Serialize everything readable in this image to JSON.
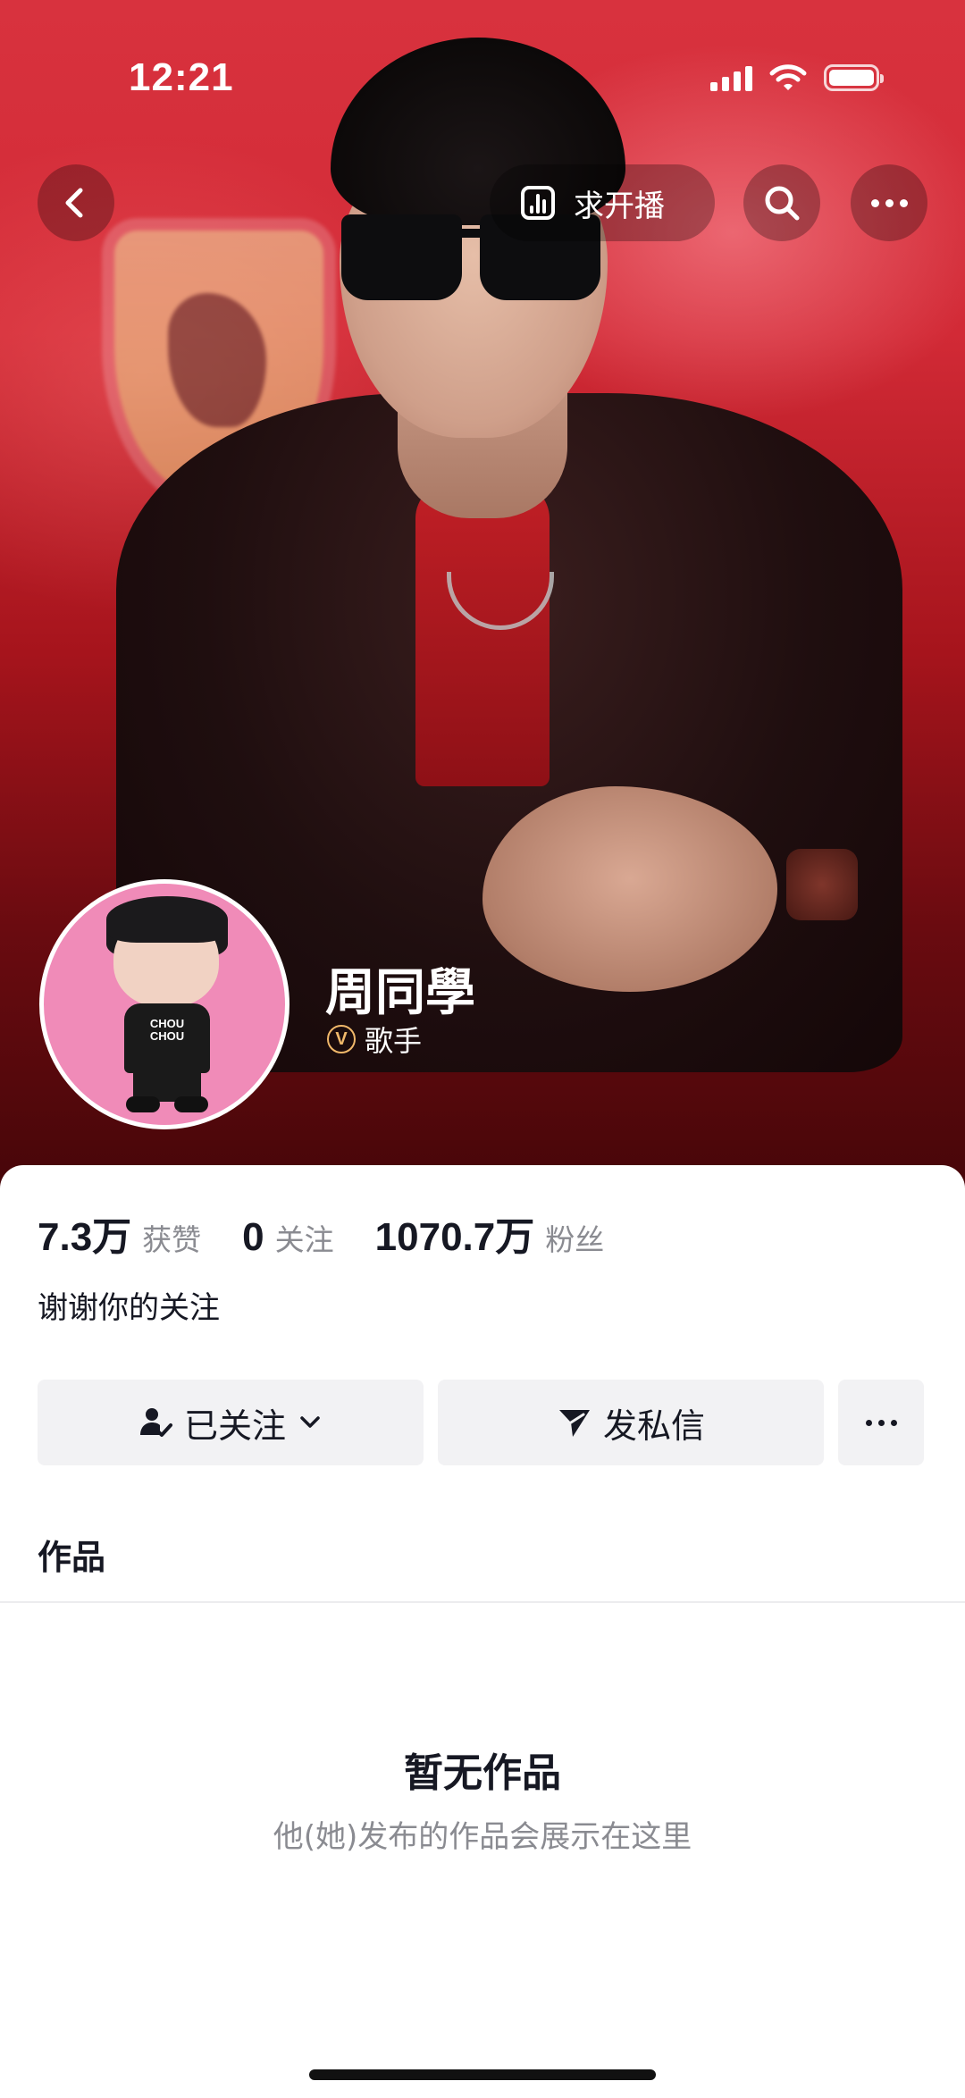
{
  "status_bar": {
    "time": "12:21"
  },
  "header": {
    "broadcast_label": "求开播",
    "back_icon": "chevron-left-icon",
    "search_icon": "search-icon",
    "more_icon": "more-horizontal-icon"
  },
  "profile": {
    "name": "周同學",
    "role": "歌手",
    "verified_badge": "V",
    "avatar_shirt_text": "CHOU CHOU"
  },
  "stats": [
    {
      "value": "7.3万",
      "label": "获赞"
    },
    {
      "value": "0",
      "label": "关注"
    },
    {
      "value": "1070.7万",
      "label": "粉丝"
    }
  ],
  "bio": "谢谢你的关注",
  "actions": {
    "follow_label": "已关注",
    "message_label": "发私信"
  },
  "tabs": {
    "works": "作品"
  },
  "empty_state": {
    "title": "暂无作品",
    "subtitle": "他(她)发布的作品会展示在这里"
  },
  "colors": {
    "hero_red": "#d22a36",
    "hero_dark": "#470609",
    "avatar_bg": "#f08bb8",
    "badge_gold": "#f0b86a",
    "button_bg": "#f2f2f4",
    "muted_text": "#8a8b91"
  }
}
